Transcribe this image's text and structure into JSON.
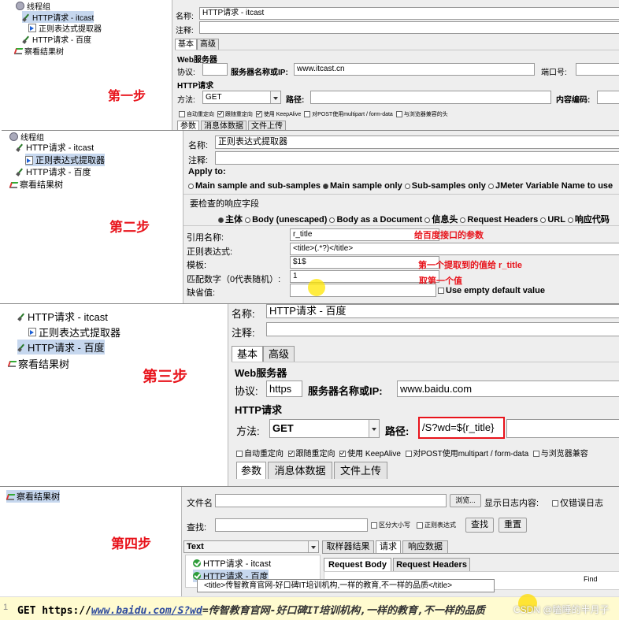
{
  "steps": {
    "s1": "第一步",
    "s2": "第二步",
    "s3": "第三步",
    "s4": "第四步"
  },
  "p1": {
    "tree": {
      "thread_group": "线程组",
      "http_itcast": "HTTP请求 - itcast",
      "extractor": "正则表达式提取器",
      "http_baidu": "HTTP请求 - 百度",
      "results_tree": "察看结果树"
    },
    "name_label": "名称:",
    "name_value": "HTTP请求 - itcast",
    "comment_label": "注释:",
    "tab_basic": "基本",
    "tab_advanced": "高级",
    "web_server": "Web服务器",
    "protocol_label": "协议:",
    "server_label": "服务器名称或IP:",
    "server_value": "www.itcast.cn",
    "port_label": "端口号:",
    "http_request": "HTTP请求",
    "method_label": "方法:",
    "method_value": "GET",
    "path_label": "路径:",
    "encoding_label": "内容编码:",
    "opt_redirect": "自动重定向",
    "opt_follow": "跟随重定向",
    "opt_keepalive": "使用 KeepAlive",
    "opt_multipart": "对POST使用multipart / form-data",
    "opt_browser": "与浏览器兼容的头",
    "tab_params": "参数",
    "tab_body": "消息体数据",
    "tab_files": "文件上传"
  },
  "p2": {
    "tree": {
      "thread_group": "线程组",
      "http_itcast": "HTTP请求 - itcast",
      "extractor": "正则表达式提取器",
      "http_baidu": "HTTP请求 - 百度",
      "results_tree": "察看结果树"
    },
    "name_label": "名称:",
    "name_value": "正则表达式提取器",
    "comment_label": "注释:",
    "apply_to": "Apply to:",
    "apply_options": [
      "Main sample and sub-samples",
      "Main sample only",
      "Sub-samples only",
      "JMeter Variable Name to use"
    ],
    "field_check": "要检查的响应字段",
    "field_options": [
      "主体",
      "Body (unescaped)",
      "Body as a Document",
      "信息头",
      "Request Headers",
      "URL",
      "响应代码"
    ],
    "ref_label": "引用名称:",
    "ref_value": "r_title",
    "regex_label": "正则表达式:",
    "regex_value": "<title>(.*?)</title>",
    "tpl_label": "模板:",
    "tpl_value": "$1$",
    "match_label": "匹配数字（0代表随机）:",
    "match_value": "1",
    "default_label": "缺省值:",
    "empty_default": "Use empty default value",
    "anno_ref": "给百度接口的参数",
    "anno_tpl": "第一个提取到的值给  r_title",
    "anno_match": "取第一个值"
  },
  "p3": {
    "tree": {
      "http_itcast": "HTTP请求 - itcast",
      "extractor": "正则表达式提取器",
      "http_baidu": "HTTP请求 - 百度",
      "results_tree": "察看结果树"
    },
    "name_label": "名称:",
    "name_value": "HTTP请求 - 百度",
    "comment_label": "注释:",
    "tab_basic": "基本",
    "tab_advanced": "高级",
    "web_server": "Web服务器",
    "protocol_label": "协议:",
    "protocol_value": "https",
    "server_label": "服务器名称或IP:",
    "server_value": "www.baidu.com",
    "http_request": "HTTP请求",
    "method_label": "方法:",
    "method_value": "GET",
    "path_label": "路径:",
    "path_value": "/S?wd=${r_title}",
    "opt_redirect": "自动重定向",
    "opt_follow": "跟随重定向",
    "opt_keepalive": "使用 KeepAlive",
    "opt_multipart": "对POST使用multipart / form-data",
    "opt_browser": "与浏览器兼容",
    "tab_params": "参数",
    "tab_body": "消息体数据",
    "tab_files": "文件上传"
  },
  "p4": {
    "tree": {
      "results_tree": "察看结果树"
    },
    "file_label": "文件名",
    "browse": "浏览...",
    "show_log": "显示日志内容:",
    "errors_only": "仅错误日志",
    "search_label": "查找:",
    "case_sensitive": "区分大小写",
    "regex": "正则表达式",
    "find_btn": "查找",
    "reset_btn": "重置",
    "renderer": "Text",
    "tab_sampler": "取样器结果",
    "tab_request": "请求",
    "tab_response": "响应数据",
    "result_items": [
      "HTTP请求 - itcast",
      "HTTP请求 - 百度"
    ],
    "tab_req_body": "Request Body",
    "tab_req_headers": "Request Headers",
    "find_small": "Find",
    "tooltip": "<title>传智教育官网-好口碑IT培训机构,一样的教育,不一样的品质</title>",
    "get_prefix": "GET https://",
    "get_url": "www.baidu.com/S?wd",
    "get_rest": "=传智教育官网-好口碑IT培训机构,一样的教育,不一样的品质",
    "watermark": "CSDN @瞌睡的半月子"
  },
  "colors": {
    "step_red": "#e8131b",
    "selection": "#c6d7ee",
    "highlight_yellow": "#fffbd0"
  }
}
